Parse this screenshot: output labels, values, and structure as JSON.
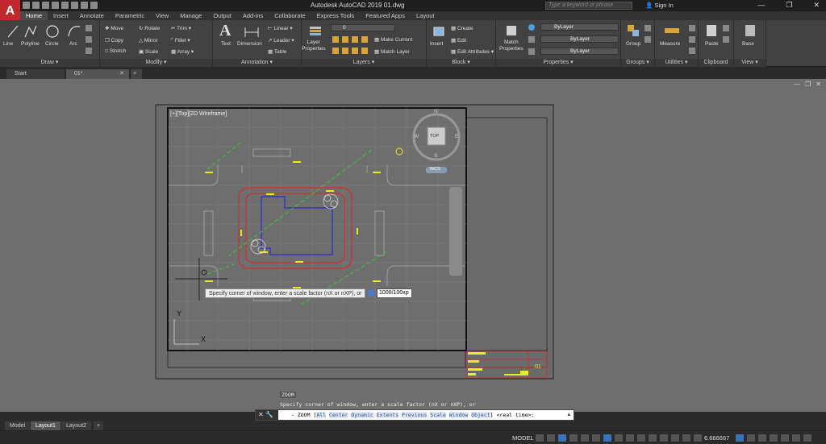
{
  "app": {
    "title": "Autodesk AutoCAD 2019    01.dwg",
    "search_placeholder": "Type a keyword or phrase",
    "signin": "Sign In",
    "logo": "A"
  },
  "ribbon_tabs": [
    "Home",
    "Insert",
    "Annotate",
    "Parametric",
    "View",
    "Manage",
    "Output",
    "Add-ins",
    "Collaborate",
    "Express Tools",
    "Featured Apps",
    "Layout"
  ],
  "ribbon": {
    "draw": {
      "title": "Draw",
      "line": "Line",
      "polyline": "Polyline",
      "circle": "Circle",
      "arc": "Arc"
    },
    "modify": {
      "title": "Modify",
      "move": "Move",
      "rotate": "Rotate",
      "trim": "Trim",
      "copy": "Copy",
      "mirror": "Mirror",
      "fillet": "Fillet",
      "stretch": "Stretch",
      "scale": "Scale",
      "array": "Array"
    },
    "annotation": {
      "title": "Annotation",
      "text": "Text",
      "dimension": "Dimension",
      "linear": "Linear",
      "leader": "Leader",
      "table": "Table"
    },
    "layers": {
      "title": "Layers",
      "layer_properties": "Layer Properties",
      "current_layer": "0",
      "make_current": "Make Current",
      "match_layer": "Match Layer"
    },
    "block": {
      "title": "Block",
      "insert": "Insert",
      "create": "Create",
      "edit": "Edit",
      "edit_attributes": "Edit Attributes"
    },
    "properties": {
      "title": "Properties",
      "match_properties": "Match Properties",
      "color": "ByLayer",
      "linetype": "ByLayer",
      "lineweight": "ByLayer"
    },
    "groups": {
      "title": "Groups",
      "group": "Group"
    },
    "utilities": {
      "title": "Utilities",
      "measure": "Measure"
    },
    "clipboard": {
      "title": "Clipboard",
      "paste": "Paste"
    },
    "view": {
      "title": "View",
      "base": "Base"
    }
  },
  "file_tabs": {
    "start": "Start",
    "current": "01*"
  },
  "viewport": {
    "label": "[+][Top][2D Wireframe]",
    "compass": {
      "n": "N",
      "s": "S",
      "e": "E",
      "w": "W",
      "top": "TOP",
      "wcs": "WCS"
    },
    "ucs_x": "X",
    "ucs_y": "Y",
    "title_block_number": "01"
  },
  "tooltip": {
    "prompt": "Specify corner of window, enter a scale factor (nX or nXP), or",
    "input_value": "1000/100xp"
  },
  "command": {
    "history_tag": "ZOOM",
    "history_line": "Specify corner of window, enter a scale factor (nX or nXP), or",
    "prefix": "- ZOOM [",
    "options": [
      "All",
      "Center",
      "Dynamic",
      "Extents",
      "Previous",
      "Scale",
      "Window",
      "Object"
    ],
    "suffix": "] <real time>:"
  },
  "layout_tabs": [
    "Model",
    "Layout1",
    "Layout2"
  ],
  "status": {
    "model": "MODEL",
    "scale": "6.666667"
  }
}
